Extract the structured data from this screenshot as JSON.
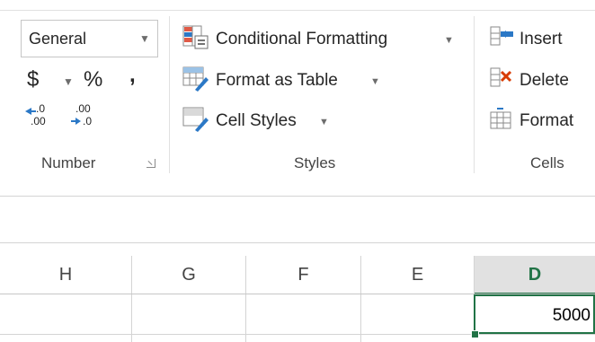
{
  "ribbon": {
    "number_group": {
      "format_value": "General",
      "currency_symbol": "$",
      "percent_symbol": "%",
      "comma_symbol": ",",
      "increase_decimal_top": ".0",
      "increase_decimal_bottom": ".00",
      "decrease_decimal_top": ".00",
      "decrease_decimal_bottom": ".0",
      "label": "Number"
    },
    "styles_group": {
      "conditional_formatting": "Conditional Formatting",
      "format_as_table": "Format as Table",
      "cell_styles": "Cell Styles",
      "label": "Styles"
    },
    "cells_group": {
      "insert": "Insert",
      "delete": "Delete",
      "format": "Format",
      "label": "Cells"
    }
  },
  "sheet": {
    "columns": [
      "H",
      "G",
      "F",
      "E",
      "D"
    ],
    "selected_column": "D",
    "active_cell_value": "5000"
  },
  "colors": {
    "accent_green": "#217346",
    "delete_red": "#d83b01"
  }
}
